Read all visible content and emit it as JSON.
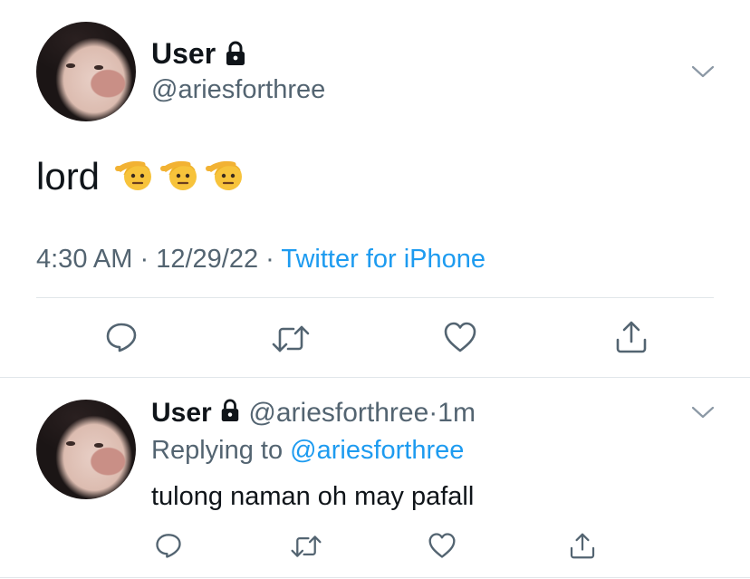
{
  "tweet": {
    "display_name": "User",
    "handle": "@ariesforthree",
    "text": "lord",
    "emoji_count": 3,
    "time": "4:30 AM",
    "sep1": "·",
    "date": "12/29/22",
    "sep2": "·",
    "source": "Twitter for iPhone"
  },
  "reply": {
    "display_name": "User",
    "handle": "@ariesforthree",
    "dot": "·",
    "age": "1m",
    "replying_prefix": "Replying to",
    "replying_to": "@ariesforthree",
    "text": "tulong naman oh may pafall"
  },
  "icons": {
    "lock": "lock-icon",
    "chevron": "chevron-down-icon",
    "reply": "reply-icon",
    "retweet": "retweet-icon",
    "like": "heart-icon",
    "share": "share-icon",
    "emoji": "saluting-face-emoji"
  },
  "colors": {
    "text": "#0f1419",
    "secondary": "#536471",
    "link": "#1d9bf0",
    "divider": "#e1e6ea"
  }
}
